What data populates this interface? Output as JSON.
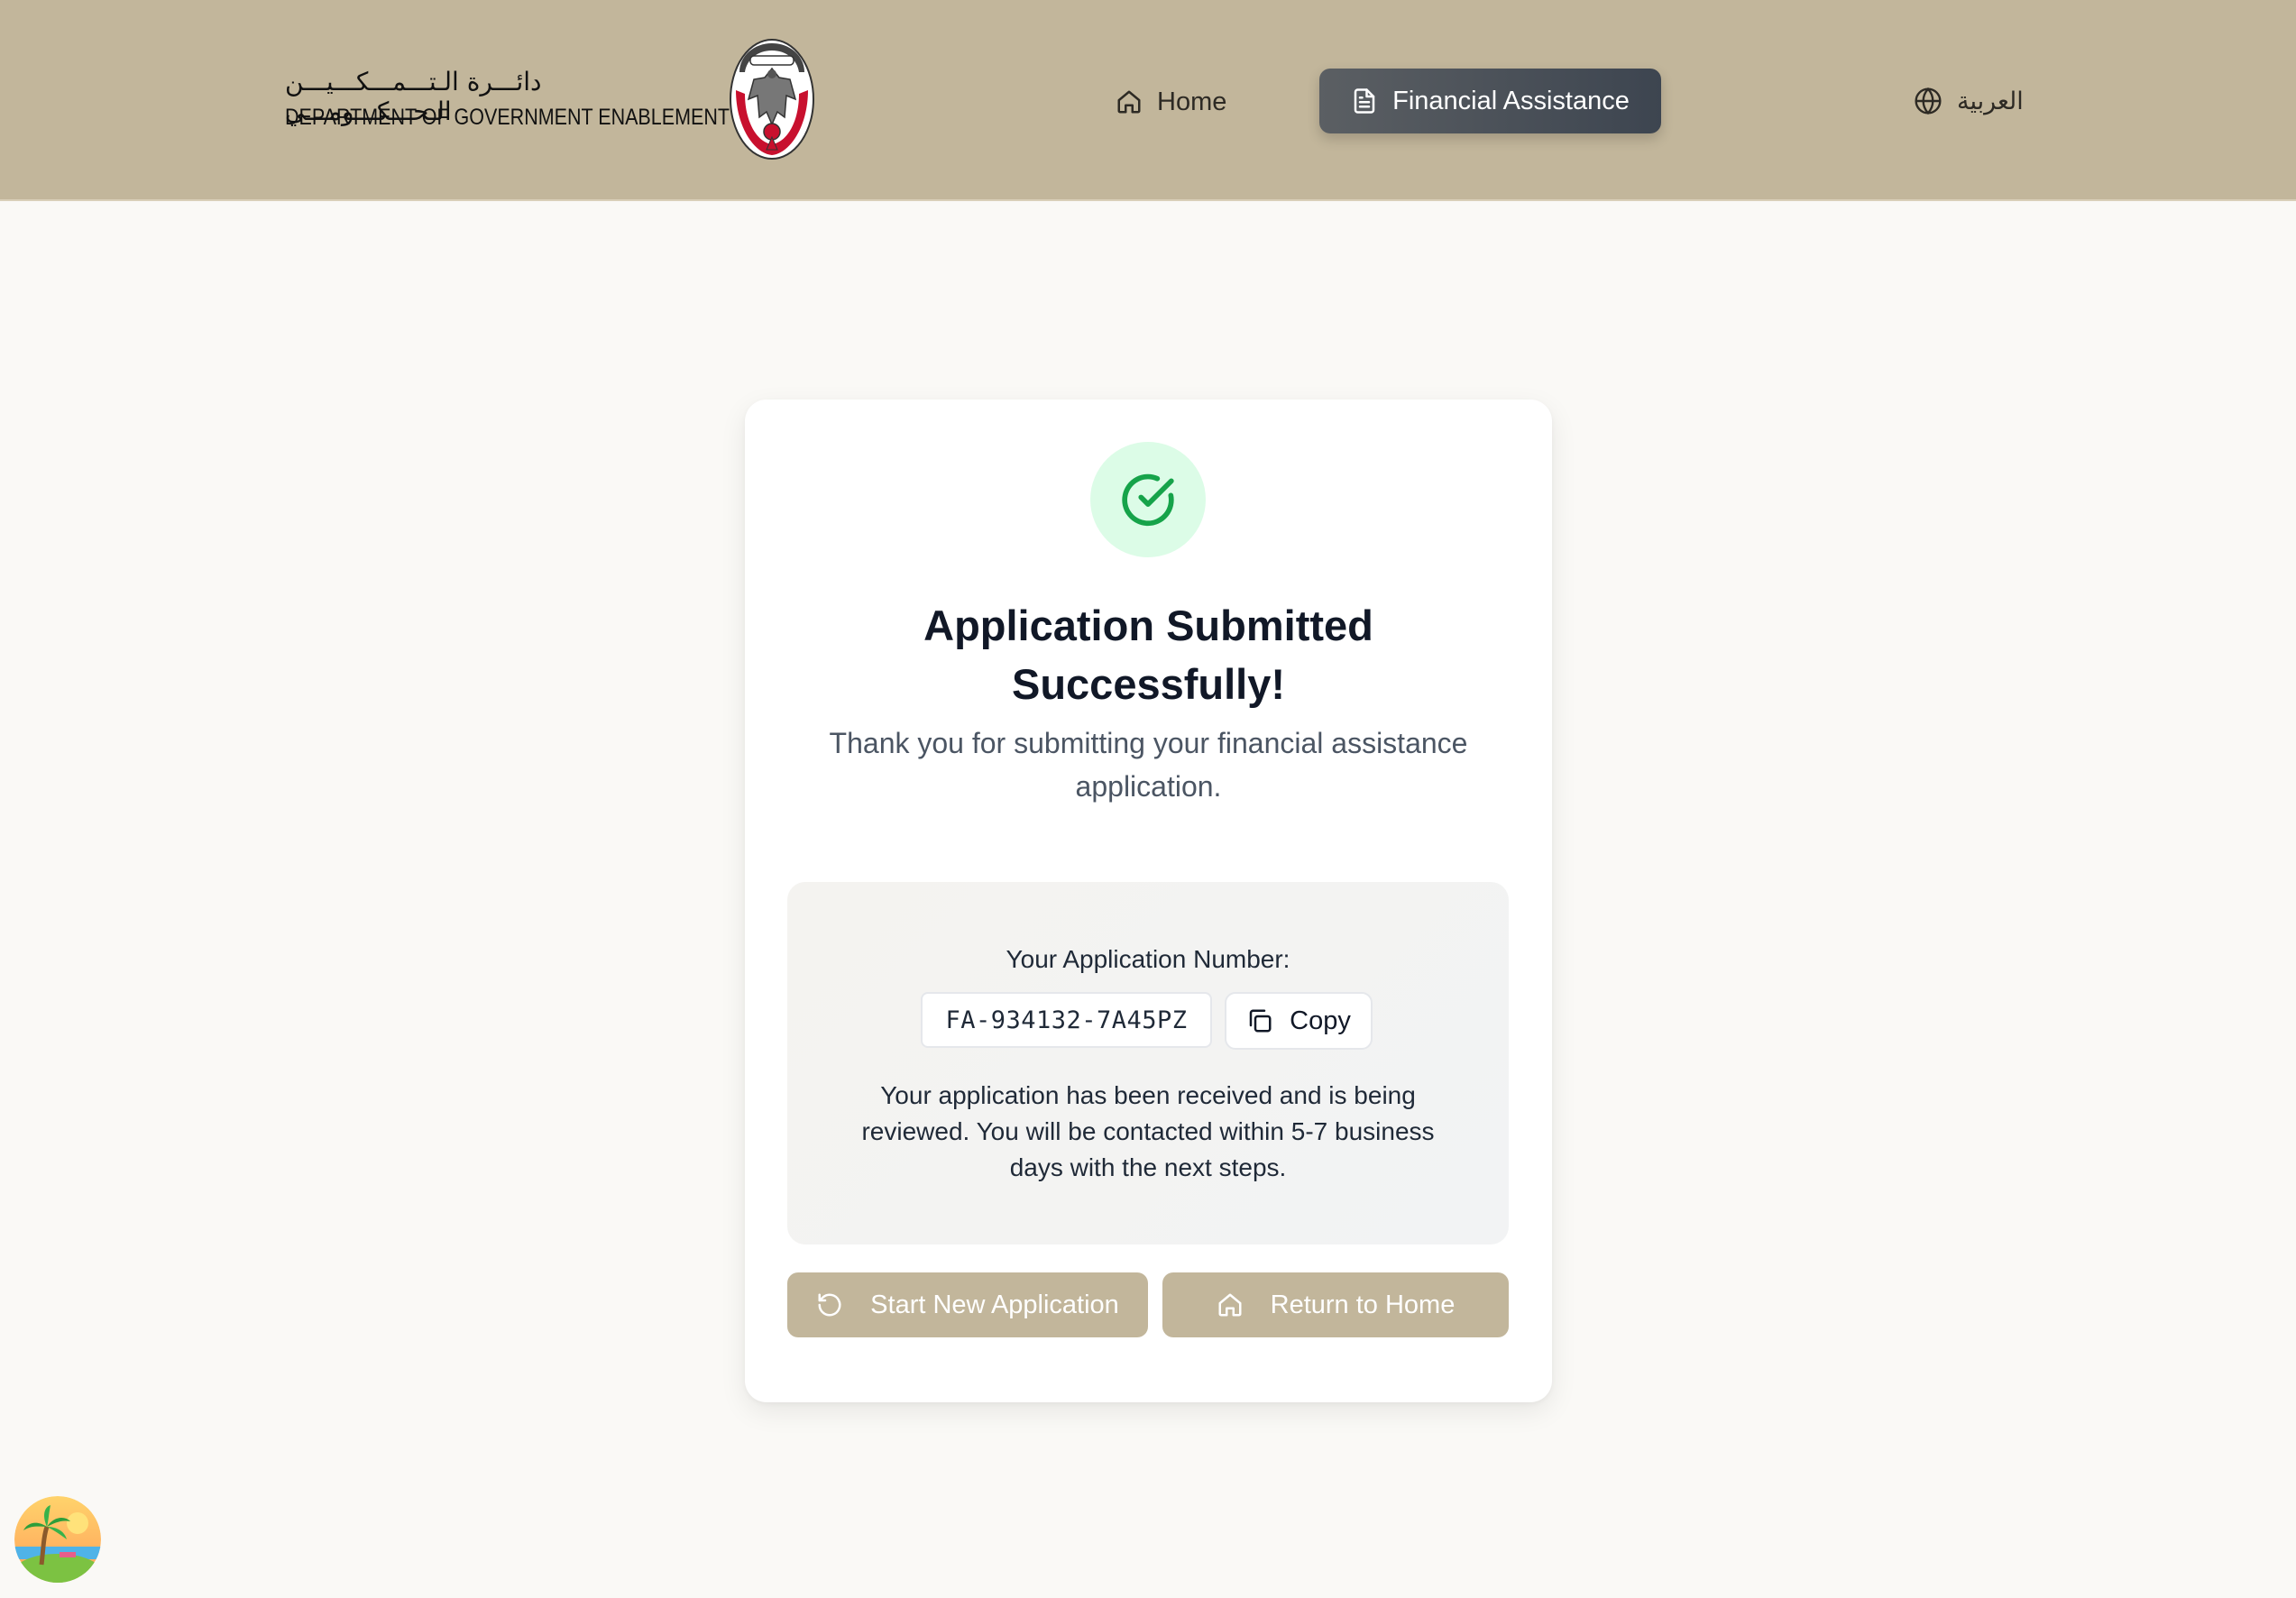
{
  "header": {
    "logo_arabic": "دائـــرة الـتـــمـــكـــيـــن الـحـــكـــومـــي",
    "logo_english": "DEPARTMENT OF GOVERNMENT ENABLEMENT",
    "nav": {
      "home_label": "Home",
      "financial_assistance_label": "Financial Assistance",
      "language_label": "العربية"
    },
    "colors": {
      "bar": "#c2b69b",
      "active_tab": "#4a4f57"
    }
  },
  "card": {
    "status_icon": "check-circle-icon",
    "title": "Application Submitted Successfully!",
    "subtitle": "Thank you for submitting your financial assistance application.",
    "application": {
      "label": "Your Application Number:",
      "number": "FA-934132-7A45PZ",
      "copy_label": "Copy",
      "description": "Your application has been received and is being reviewed. You will be contacted within 5-7 business days with the next steps."
    },
    "actions": {
      "start_new_label": "Start New Application",
      "return_home_label": "Return to Home"
    },
    "colors": {
      "success_bg": "#dcfce7",
      "success": "#16a34a",
      "button": "#c2b69b"
    }
  }
}
